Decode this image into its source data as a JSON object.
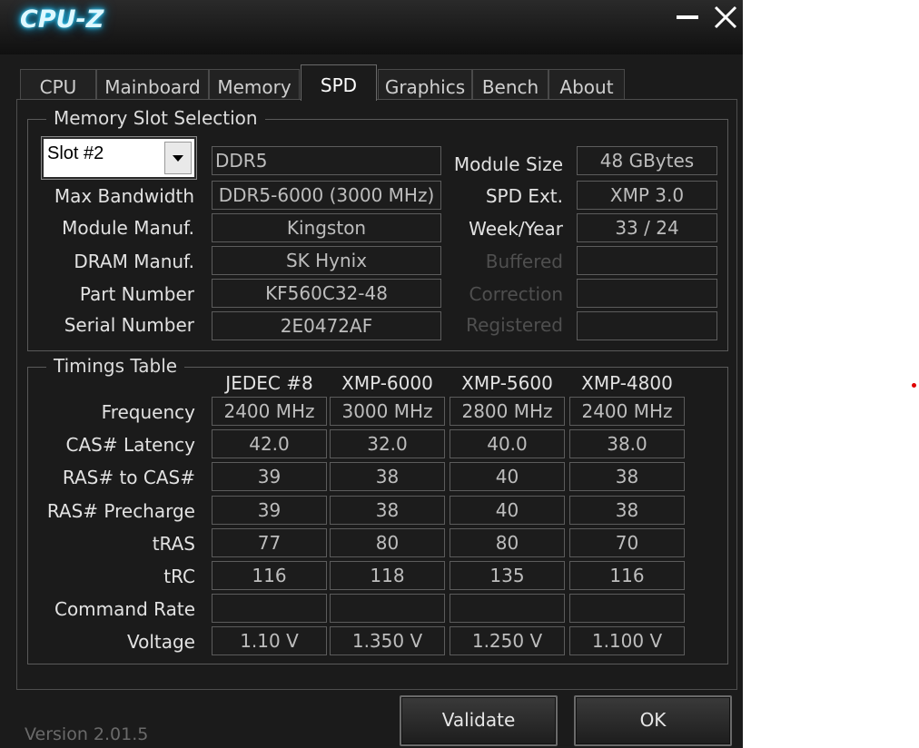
{
  "window": {
    "title": "CPU-Z"
  },
  "tabs": [
    {
      "label": "CPU"
    },
    {
      "label": "Mainboard"
    },
    {
      "label": "Memory"
    },
    {
      "label": "SPD"
    },
    {
      "label": "Graphics"
    },
    {
      "label": "Bench"
    },
    {
      "label": "About"
    }
  ],
  "slot_group": {
    "legend": "Memory Slot Selection",
    "slot_value": "Slot #2",
    "memory_type": "DDR5",
    "rows": {
      "max_bandwidth": {
        "label": "Max Bandwidth",
        "value": "DDR5-6000 (3000 MHz)"
      },
      "module_manuf": {
        "label": "Module Manuf.",
        "value": "Kingston"
      },
      "dram_manuf": {
        "label": "DRAM Manuf.",
        "value": "SK Hynix"
      },
      "part_number": {
        "label": "Part Number",
        "value": "KF560C32-48"
      },
      "serial_number": {
        "label": "Serial Number",
        "value": "2E0472AF"
      }
    },
    "right": {
      "module_size": {
        "label": "Module Size",
        "value": "48 GBytes"
      },
      "spd_ext": {
        "label": "SPD Ext.",
        "value": "XMP 3.0"
      },
      "week_year": {
        "label": "Week/Year",
        "value": "33 / 24"
      },
      "buffered": {
        "label": "Buffered",
        "value": ""
      },
      "correction": {
        "label": "Correction",
        "value": ""
      },
      "registered": {
        "label": "Registered",
        "value": ""
      }
    }
  },
  "timings": {
    "legend": "Timings Table",
    "columns": [
      "JEDEC #8",
      "XMP-6000",
      "XMP-5600",
      "XMP-4800"
    ],
    "rows": [
      {
        "label": "Frequency",
        "values": [
          "2400 MHz",
          "3000 MHz",
          "2800 MHz",
          "2400 MHz"
        ]
      },
      {
        "label": "CAS# Latency",
        "values": [
          "42.0",
          "32.0",
          "40.0",
          "38.0"
        ]
      },
      {
        "label": "RAS# to CAS#",
        "values": [
          "39",
          "38",
          "40",
          "38"
        ]
      },
      {
        "label": "RAS# Precharge",
        "values": [
          "39",
          "38",
          "40",
          "38"
        ]
      },
      {
        "label": "tRAS",
        "values": [
          "77",
          "80",
          "80",
          "70"
        ]
      },
      {
        "label": "tRC",
        "values": [
          "116",
          "118",
          "135",
          "116"
        ]
      },
      {
        "label": "Command Rate",
        "values": [
          "",
          "",
          "",
          ""
        ]
      },
      {
        "label": "Voltage",
        "values": [
          "1.10 V",
          "1.350 V",
          "1.250 V",
          "1.100 V"
        ]
      }
    ]
  },
  "footer": {
    "version": "Version 2.01.5",
    "validate_label": "Validate",
    "ok_label": "OK"
  }
}
